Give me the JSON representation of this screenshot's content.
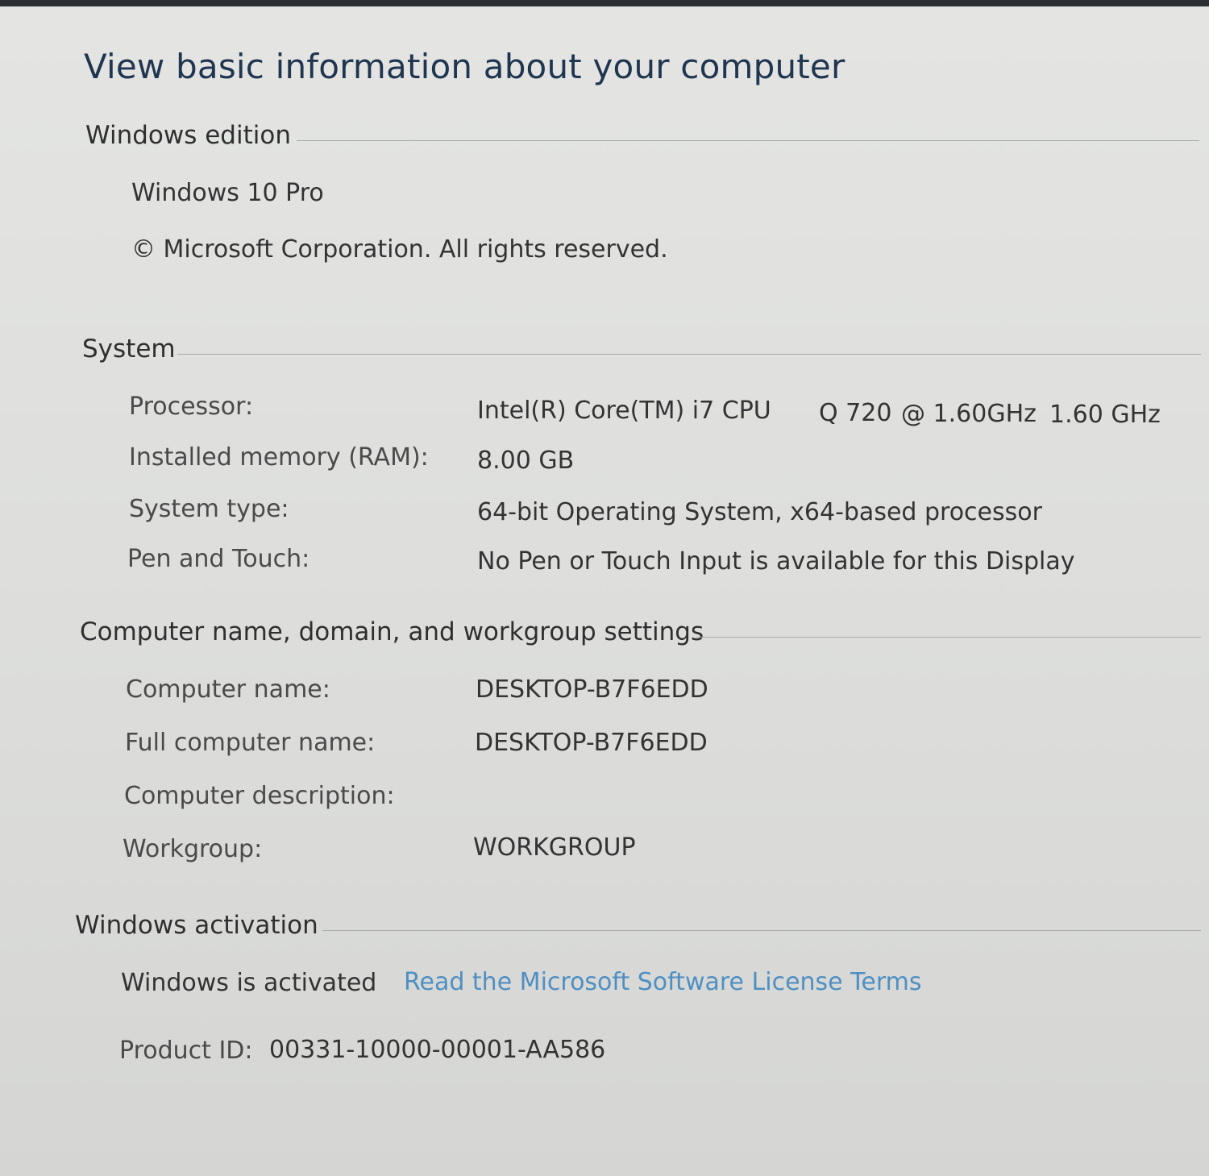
{
  "page": {
    "title": "View basic information about your computer"
  },
  "windows_edition": {
    "header": "Windows edition",
    "edition": "Windows 10 Pro",
    "copyright": "© Microsoft Corporation. All rights reserved."
  },
  "system": {
    "header": "System",
    "rows": [
      {
        "label": "Processor:",
        "value_parts": [
          "Intel(R) Core(TM) i7 CPU",
          "Q 720",
          "@ 1.60GHz",
          "1.60 GHz"
        ]
      },
      {
        "label": "Installed memory (RAM):",
        "value": "8.00 GB"
      },
      {
        "label": "System type:",
        "value": "64-bit Operating System, x64-based processor"
      },
      {
        "label": "Pen and Touch:",
        "value": "No Pen or Touch Input is available for this Display"
      }
    ]
  },
  "computer_name": {
    "header": "Computer name, domain, and workgroup settings",
    "rows": [
      {
        "label": "Computer name:",
        "value": "DESKTOP-B7F6EDD"
      },
      {
        "label": "Full computer name:",
        "value": "DESKTOP-B7F6EDD"
      },
      {
        "label": "Computer description:",
        "value": ""
      },
      {
        "label": "Workgroup:",
        "value": "WORKGROUP"
      }
    ]
  },
  "activation": {
    "header": "Windows activation",
    "status": "Windows is activated",
    "license_link": "Read the Microsoft Software License Terms",
    "product_id_label": "Product ID:",
    "product_id_value": "00331-10000-00001-AA586"
  },
  "colors": {
    "title": "#1f3550",
    "link": "#4f8fc2",
    "background": "#dfe0de"
  }
}
